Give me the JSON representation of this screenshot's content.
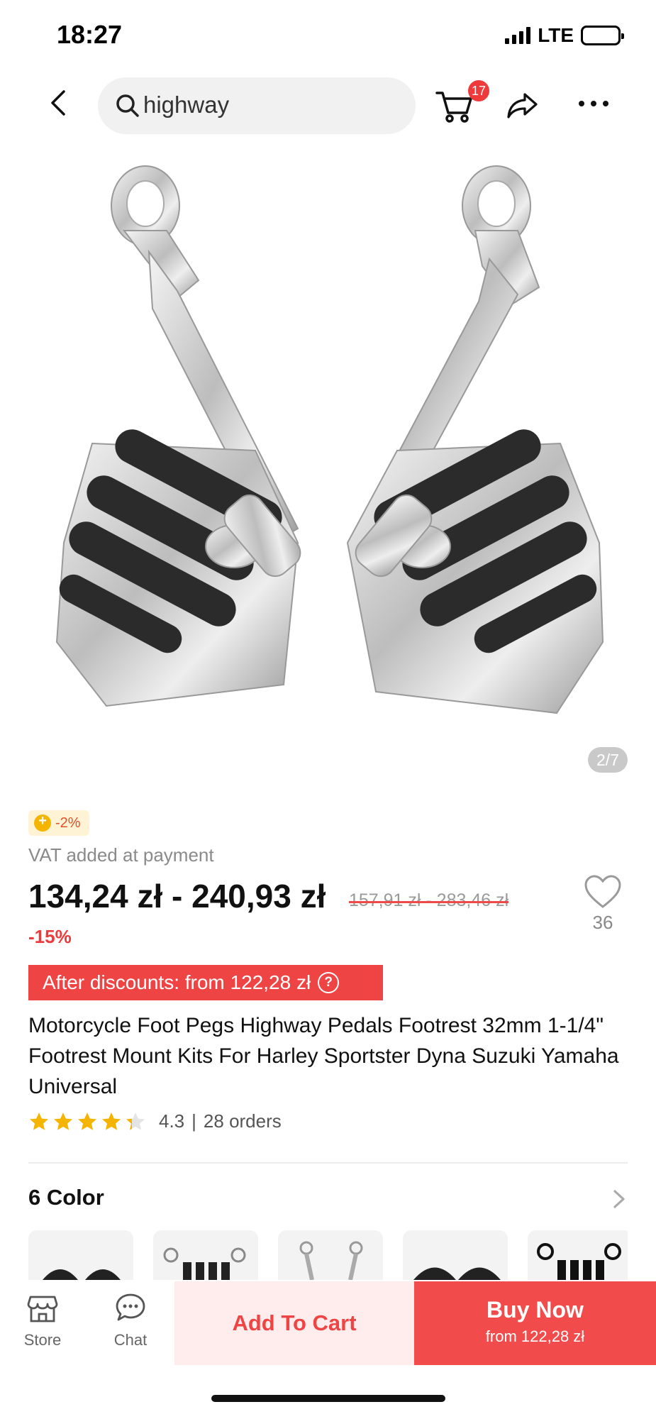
{
  "status": {
    "time": "18:27",
    "network": "LTE",
    "battery_level": 0.7
  },
  "header": {
    "search_value": "highway",
    "cart_badge": "17",
    "icons": [
      "back-arrow-icon",
      "search-icon",
      "cart-icon",
      "share-icon",
      "more-icon"
    ]
  },
  "gallery": {
    "counter": "2/7"
  },
  "product": {
    "coin_discount": "-2%",
    "vat_note": "VAT added at payment",
    "price": "134,24 zł - 240,93 zł",
    "old_price": "157,91 zł - 283,46 zł",
    "discount": "-15%",
    "after_discounts": "After discounts: from 122,28 zł",
    "wishlist_count": "36",
    "title": "Motorcycle Foot Pegs Highway Pedals Footrest 32mm 1-1/4\" Footrest Mount Kits For Harley Sportster Dyna Suzuki Yamaha Universal",
    "rating": "4.3",
    "rating_value": 4.3,
    "rating_separator": "|",
    "orders": "28 orders"
  },
  "variants": {
    "label": "6 Color"
  },
  "bottom_bar": {
    "store_label": "Store",
    "chat_label": "Chat",
    "add_to_cart": "Add To Cart",
    "buy_now": "Buy Now",
    "buy_now_sub": "from 122,28 zł"
  },
  "colors": {
    "accent": "#ef4444",
    "badge": "#ee3a3a",
    "search_bg": "#f1f1f1"
  }
}
